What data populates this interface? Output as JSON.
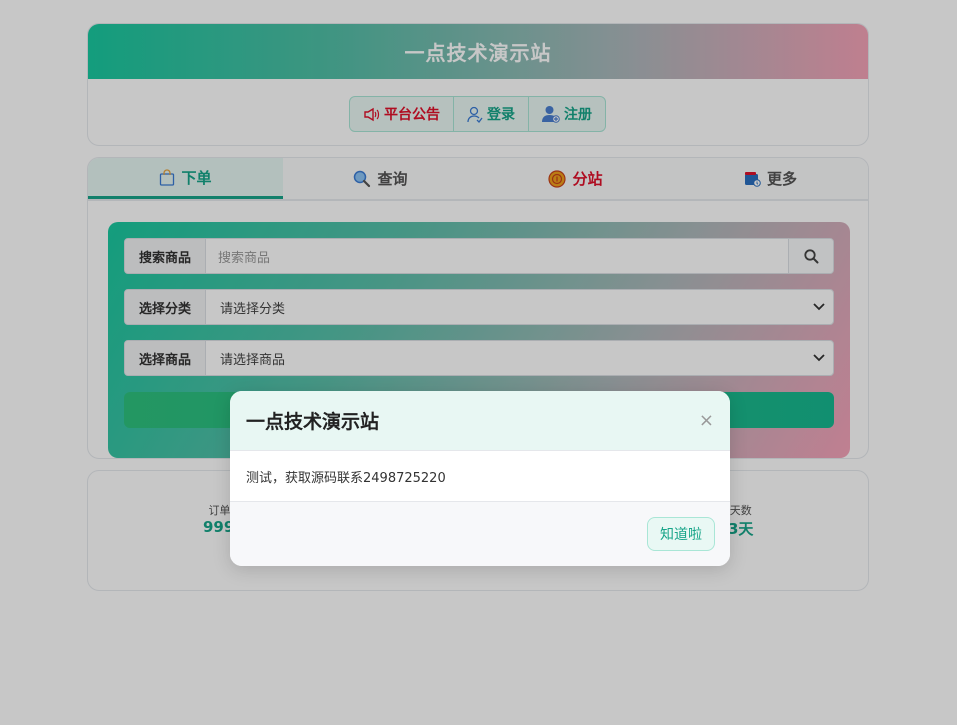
{
  "site": {
    "title": "一点技术演示站"
  },
  "top_buttons": [
    {
      "label": "平台公告",
      "icon": "megaphone-icon"
    },
    {
      "label": "登录",
      "icon": "user-icon"
    },
    {
      "label": "注册",
      "icon": "user-add-icon"
    }
  ],
  "tabs": [
    {
      "label": "下单",
      "icon": "shopping-bag-icon",
      "active": true
    },
    {
      "label": "查询",
      "icon": "search-icon"
    },
    {
      "label": "分站",
      "icon": "coin-icon"
    },
    {
      "label": "更多",
      "icon": "wallet-icon"
    }
  ],
  "form": {
    "search": {
      "label": "搜索商品",
      "placeholder": "搜索商品"
    },
    "category": {
      "label": "选择分类",
      "value": "请选择分类"
    },
    "product": {
      "label": "选择商品",
      "value": "请选择商品"
    }
  },
  "stats": {
    "left": {
      "label": "订单总",
      "value": "999+"
    },
    "right": {
      "label": "天数",
      "value": "3天"
    }
  },
  "modal": {
    "title": "一点技术演示站",
    "close": "×",
    "body": "测试，获取源码联系2498725220",
    "ok_label": "知道啦"
  },
  "colors": {
    "accent": "#17a589",
    "notice": "#e0112b"
  }
}
